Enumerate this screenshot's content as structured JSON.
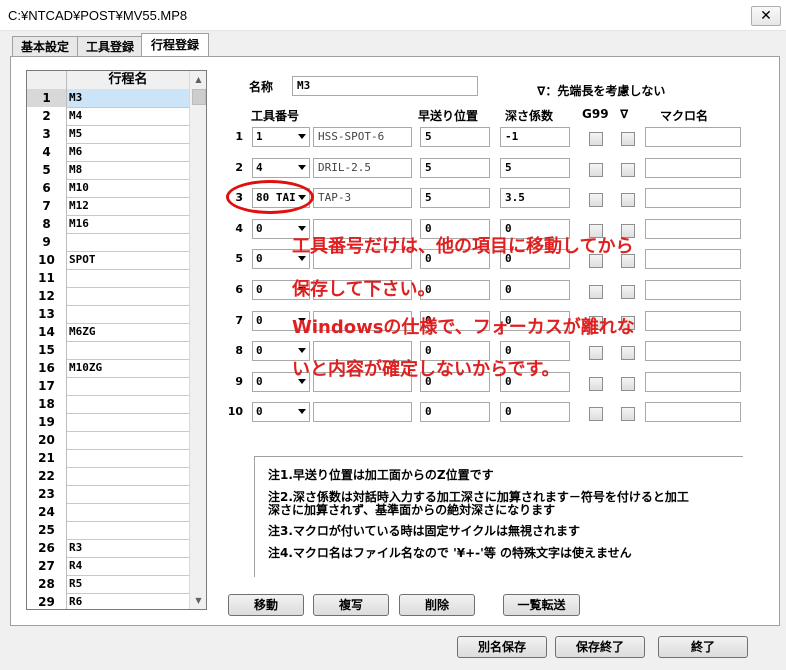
{
  "window": {
    "title": "C:¥NTCAD¥POST¥MV55.MP8",
    "close": "✕"
  },
  "tabs": [
    {
      "label": "基本設定"
    },
    {
      "label": "工具登録"
    },
    {
      "label": "行程登録"
    }
  ],
  "list": {
    "header": "行程名",
    "rows": [
      {
        "n": "1",
        "v": "M3"
      },
      {
        "n": "2",
        "v": "M4"
      },
      {
        "n": "3",
        "v": "M5"
      },
      {
        "n": "4",
        "v": "M6"
      },
      {
        "n": "5",
        "v": "M8"
      },
      {
        "n": "6",
        "v": "M10"
      },
      {
        "n": "7",
        "v": "M12"
      },
      {
        "n": "8",
        "v": "M16"
      },
      {
        "n": "9",
        "v": ""
      },
      {
        "n": "10",
        "v": "SPOT"
      },
      {
        "n": "11",
        "v": ""
      },
      {
        "n": "12",
        "v": ""
      },
      {
        "n": "13",
        "v": ""
      },
      {
        "n": "14",
        "v": "M6ZG"
      },
      {
        "n": "15",
        "v": ""
      },
      {
        "n": "16",
        "v": "M10ZG"
      },
      {
        "n": "17",
        "v": ""
      },
      {
        "n": "18",
        "v": ""
      },
      {
        "n": "19",
        "v": ""
      },
      {
        "n": "20",
        "v": ""
      },
      {
        "n": "21",
        "v": ""
      },
      {
        "n": "22",
        "v": ""
      },
      {
        "n": "23",
        "v": ""
      },
      {
        "n": "24",
        "v": ""
      },
      {
        "n": "25",
        "v": ""
      },
      {
        "n": "26",
        "v": "R3"
      },
      {
        "n": "27",
        "v": "R4"
      },
      {
        "n": "28",
        "v": "R5"
      },
      {
        "n": "29",
        "v": "R6"
      }
    ],
    "up_arrow": "▲",
    "down_arrow": "▼"
  },
  "form": {
    "name_label": "名称",
    "name_value": "M3",
    "hint": "∇：先端長を考慮しない",
    "headers": {
      "tool_no": "工具番号",
      "rapid": "早送り位置",
      "depth": "深さ係数",
      "g99": "G99",
      "nabla": "∇",
      "macro": "マクロ名"
    },
    "steps": [
      {
        "num": "1",
        "tool": "1",
        "tool_name": "HSS-SPOT-6",
        "rapid": "5",
        "depth": "-1",
        "macro": ""
      },
      {
        "num": "2",
        "tool": "4",
        "tool_name": "DRIL-2.5",
        "rapid": "5",
        "depth": "5",
        "macro": ""
      },
      {
        "num": "3",
        "tool": "80 TAI",
        "tool_name": "TAP-3",
        "rapid": "5",
        "depth": "3.5",
        "macro": ""
      },
      {
        "num": "4",
        "tool": "0",
        "tool_name": "",
        "rapid": "0",
        "depth": "0",
        "macro": ""
      },
      {
        "num": "5",
        "tool": "0",
        "tool_name": "",
        "rapid": "0",
        "depth": "0",
        "macro": ""
      },
      {
        "num": "6",
        "tool": "0",
        "tool_name": "",
        "rapid": "0",
        "depth": "0",
        "macro": ""
      },
      {
        "num": "7",
        "tool": "0",
        "tool_name": "",
        "rapid": "0",
        "depth": "0",
        "macro": ""
      },
      {
        "num": "8",
        "tool": "0",
        "tool_name": "",
        "rapid": "0",
        "depth": "0",
        "macro": ""
      },
      {
        "num": "9",
        "tool": "0",
        "tool_name": "",
        "rapid": "0",
        "depth": "0",
        "macro": ""
      },
      {
        "num": "10",
        "tool": "0",
        "tool_name": "",
        "rapid": "0",
        "depth": "0",
        "macro": ""
      }
    ]
  },
  "notes": [
    "注1.早送り位置は加工面からのZ位置です",
    "注2.深さ係数は対話時入力する加工深さに加算されます－符号を付けると加工",
    "深さに加算されず、基準面からの絶対深さになります",
    "注3.マクロが付いている時は固定サイクルは無視されます",
    "注4.マクロ名はファイル名なので '¥+-'等 の特殊文字は使えません"
  ],
  "buttons": {
    "move": "移動",
    "copy": "複写",
    "delete": "削除",
    "list_transfer": "一覧転送",
    "save_as": "別名保存",
    "save_exit": "保存終了",
    "exit": "終了"
  },
  "overlay": {
    "line1": "工具番号だけは、他の項目に移動してから",
    "line2": "保存して下さい。",
    "line3": "Windowsの仕様で、フォーカスが離れな",
    "line4": "いと内容が確定しないからです。"
  },
  "colors": {
    "annotation": "#e02020",
    "selection": "#cce4f7"
  }
}
